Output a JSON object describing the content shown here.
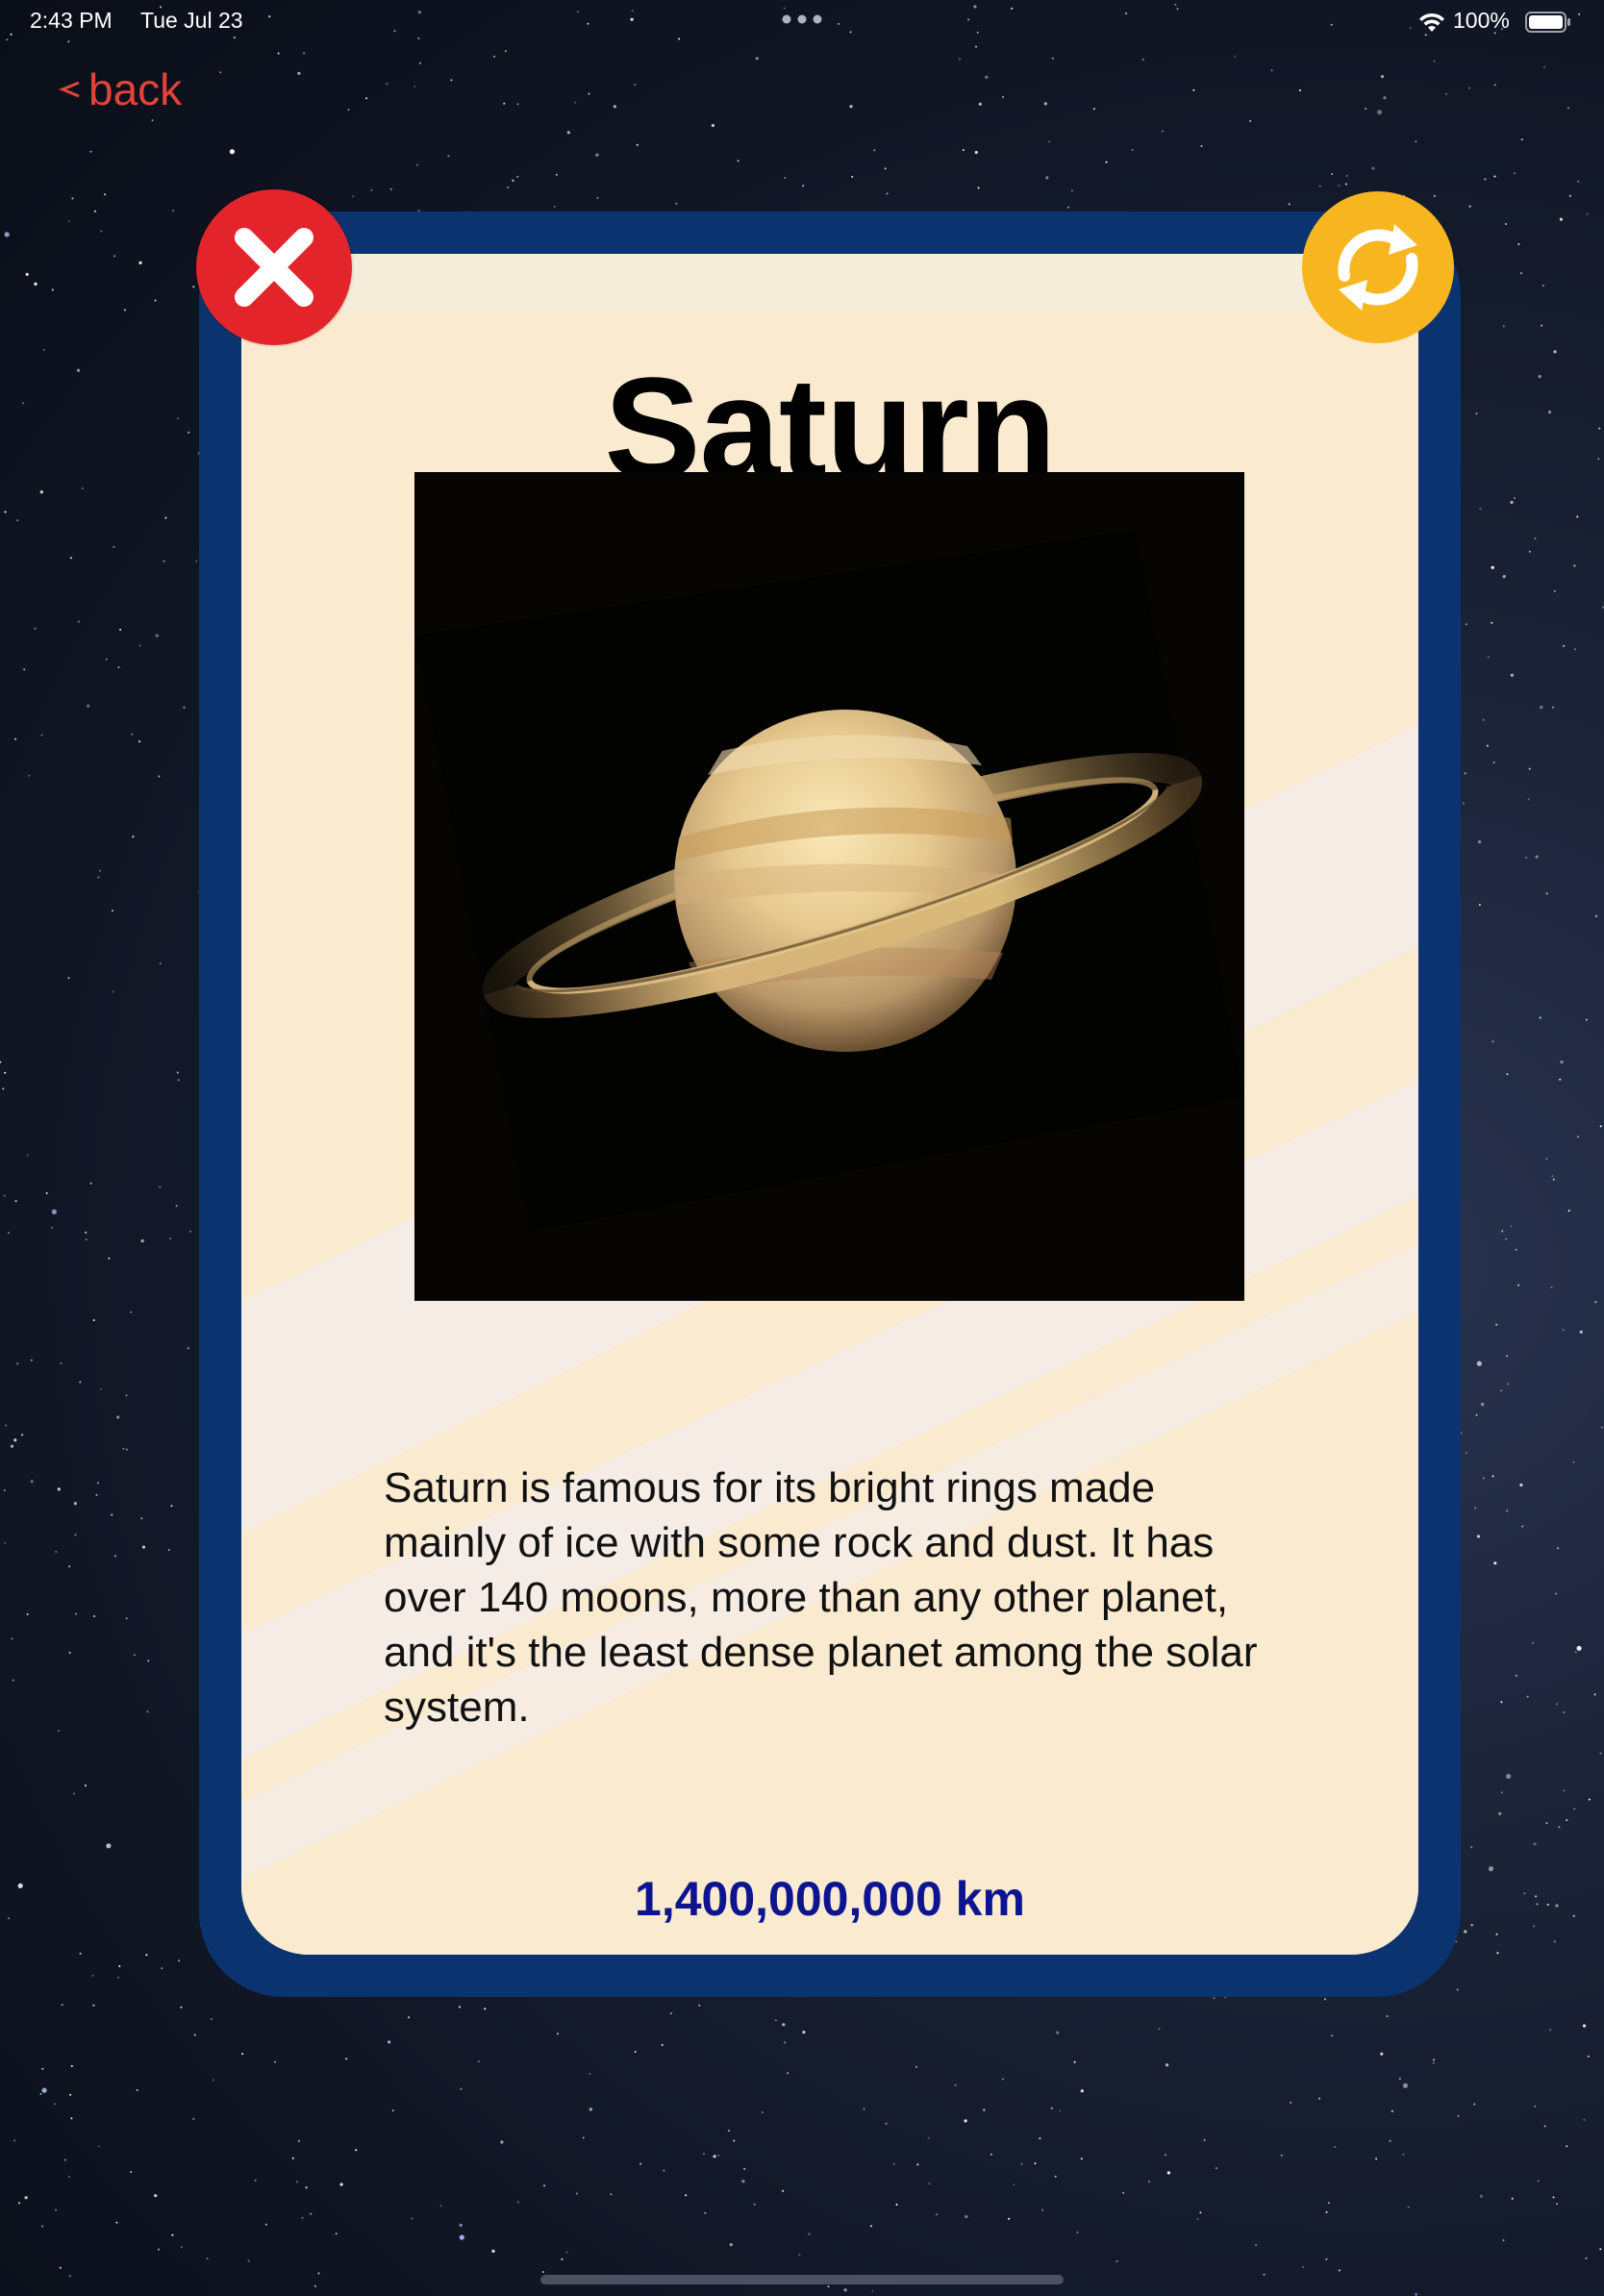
{
  "status_bar": {
    "time": "2:43 PM",
    "date": "Tue Jul 23",
    "battery": "100%"
  },
  "nav": {
    "back_label": "back"
  },
  "card": {
    "title": "Saturn",
    "description": "Saturn is famous for its bright rings made mainly of ice with some rock and dust. It has over 140 moons, more than any other planet, and it's the least dense planet among the solar system.",
    "distance": "1,400,000,000 km"
  },
  "icons": {
    "close": "close-icon",
    "refresh": "refresh-icon",
    "back": "chevron-left-icon",
    "wifi": "wifi-icon",
    "battery": "battery-icon"
  },
  "colors": {
    "card_border": "#0b336f",
    "card_fill": "#f8eacf",
    "back_text": "#e0443a",
    "distance_text": "#0c1490",
    "close_badge": "#e3242b",
    "refresh_badge": "#f7b520"
  }
}
